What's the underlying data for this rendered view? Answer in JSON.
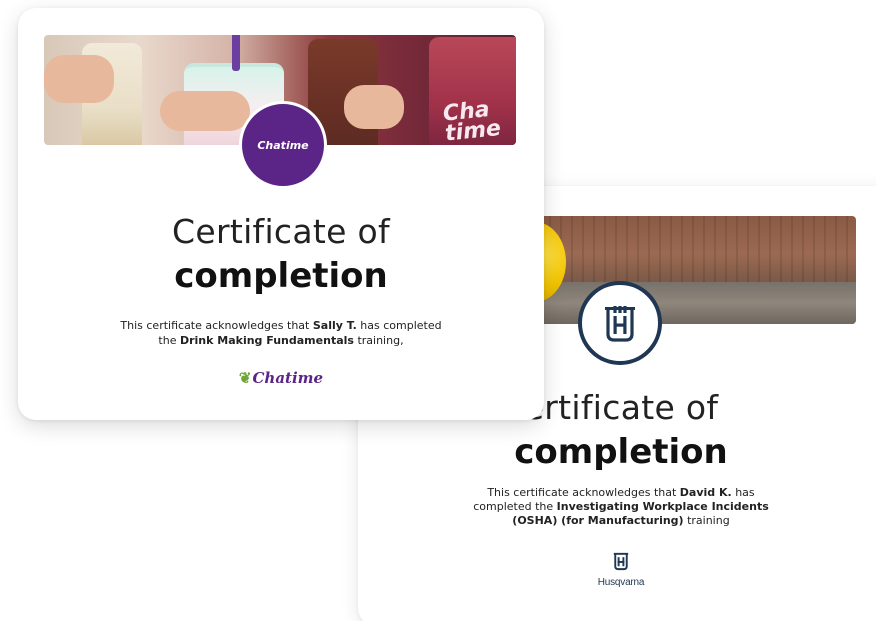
{
  "front_card": {
    "banner_text": "Cha time",
    "logo_label": "Chatime",
    "title_line1": "Certificate of",
    "title_line2": "completion",
    "body_prefix": "This certificate acknowledges that",
    "recipient": "Sally T.",
    "body_middle": "has completed the",
    "course": "Drink Making Fundamentals",
    "body_suffix": "training,",
    "footer_brand": "Chatime",
    "brand_color": "#5b2487"
  },
  "back_card": {
    "title_line1": "ertificate of",
    "title_line2": "completion",
    "body_prefix": "This certificate acknowledges that",
    "recipient": "David K.",
    "body_middle": "has completed the",
    "course": "Investigating Workplace Incidents (OSHA) (for Manufacturing)",
    "body_suffix": "training",
    "footer_brand": "Husqvarna",
    "brand_color": "#1f3752"
  }
}
